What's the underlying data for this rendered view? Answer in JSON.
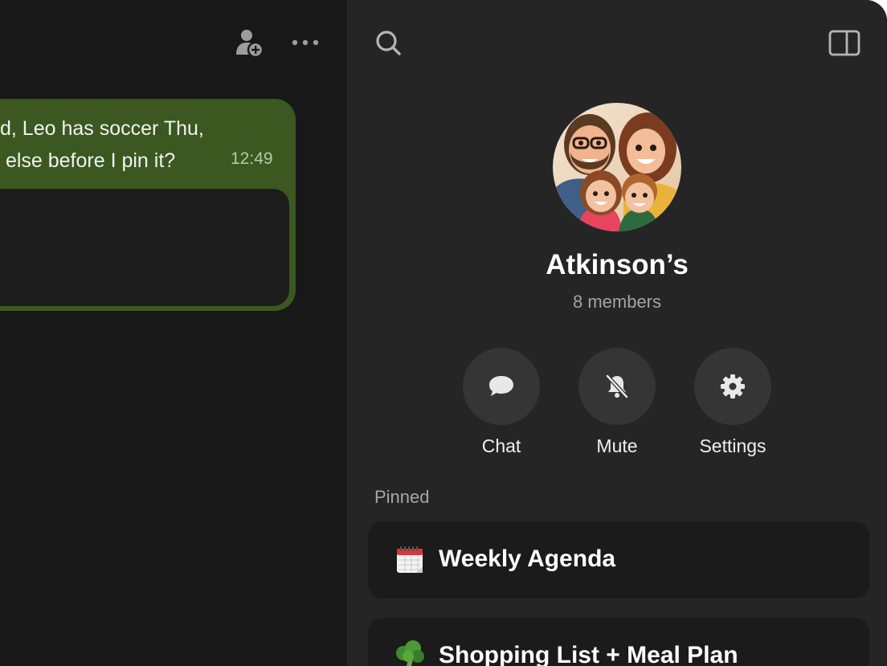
{
  "chat": {
    "message_text": "d, Leo has soccer Thu,\n else before I pin it?",
    "message_time": "12:49"
  },
  "group": {
    "name": "Atkinson’s",
    "members": "8 members"
  },
  "actions": [
    {
      "label": "Chat",
      "icon": "speech-bubble-icon"
    },
    {
      "label": "Mute",
      "icon": "bell-slash-icon"
    },
    {
      "label": "Settings",
      "icon": "gear-icon"
    }
  ],
  "pinned": {
    "section_label": "Pinned",
    "items": [
      {
        "title": "Weekly Agenda",
        "icon": "calendar-icon"
      },
      {
        "title": "Shopping List + Meal Plan",
        "icon": "broccoli-icon"
      }
    ]
  },
  "colors": {
    "bubble_green": "#3a5820",
    "panel_bg": "#252525",
    "chat_bg": "#181818"
  }
}
